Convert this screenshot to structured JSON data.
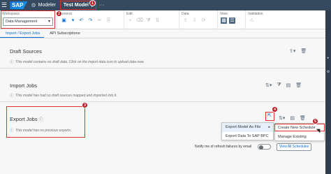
{
  "shell": {
    "logo": "SAP",
    "app": "Modeler",
    "model": "Test Model",
    "model_chevron": "▾",
    "more": "···"
  },
  "toolbar": {
    "groups": {
      "workspace": "Workspace",
      "general": "General",
      "edit": "Edit",
      "data": "Data",
      "view": "View",
      "validation": "Validation"
    },
    "workspace_value": "Data Management"
  },
  "tabs": [
    {
      "label": "Import / Export Jobs",
      "active": true
    },
    {
      "label": "API Subscriptions",
      "active": false
    }
  ],
  "sections": {
    "draft": {
      "title": "Draft Sources",
      "info": "This model contains no draft data. Click on the import data icon to upload data now."
    },
    "import": {
      "title": "Import Jobs",
      "info": "This model has had no draft sources mapped and imported into it."
    },
    "export": {
      "title": "Export Jobs",
      "info": "This model has no previous exports."
    }
  },
  "export_menu": {
    "items": [
      "Export Model As File",
      "Export Data To SAP BPC"
    ],
    "submenu": [
      "Create New Schedule",
      "Manage Existing Schedules"
    ]
  },
  "footer": {
    "notify_label": "Notify me of refresh failures by email",
    "view_all_label": "View All Schedules"
  },
  "badges": [
    "1",
    "2",
    "3",
    "4",
    "5"
  ],
  "colors": {
    "shell_bg": "#354a5f",
    "accent": "#0a6ed1",
    "annotation": "#e03030",
    "badge": "#b9181e"
  }
}
